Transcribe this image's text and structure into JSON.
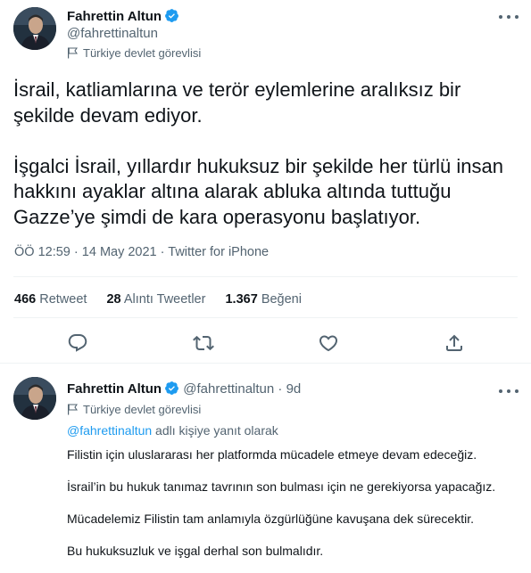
{
  "tweet": {
    "author_name": "Fahrettin Altun",
    "handle": "@fahrettinaltun",
    "label": "Türkiye devlet görevlisi",
    "paragraphs": [
      [
        "İsrail, katliamlarına ve terör eylemlerine aralıksız bir",
        "şekilde devam ediyor."
      ],
      [
        "İşgalci İsrail, yıllardır hukuksuz bir şekilde her türlü insan",
        "hakkını ayaklar altına alarak abluka altında tuttuğu",
        "Gazze’ye şimdi de kara operasyonu başlatıyor."
      ]
    ],
    "time": "ÖÖ 12:59",
    "date": "14 May 2021",
    "dot": "·",
    "source": "Twitter for iPhone",
    "stats": {
      "retweets_count": "466",
      "retweets_label": "Retweet",
      "quotes_count": "28",
      "quotes_label": "Alıntı Tweetler",
      "likes_count": "1.367",
      "likes_label": "Beğeni"
    },
    "actions": [
      "reply-icon",
      "retweet-icon",
      "like-icon",
      "share-icon"
    ]
  },
  "reply": {
    "author_name": "Fahrettin Altun",
    "handle": "@fahrettinaltun",
    "dot": "·",
    "time": "9d",
    "label": "Türkiye devlet görevlisi",
    "replying_mention": "@fahrettinaltun",
    "replying_suffix": "adlı kişiye yanıt olarak",
    "lines": [
      "Filistin için uluslararası her platformda mücadele etmeye devam edeceğiz.",
      "İsrail’in bu hukuk tanımaz tavrının son bulması için ne gerekiyorsa yapacağız.",
      "Mücadelemiz Filistin tam anlamıyla özgürlüğüne kavuşana dek sürecektir.",
      "Bu hukuksuzluk ve işgal derhal son bulmalıdır."
    ]
  },
  "colors": {
    "text": "#0f1419",
    "secondary": "#536471",
    "accent": "#1d9bf0",
    "divider": "#eff3f4"
  }
}
